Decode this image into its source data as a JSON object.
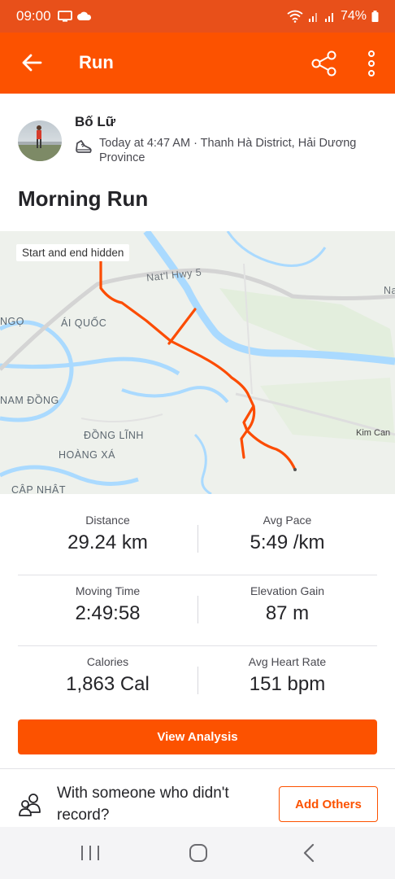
{
  "status_bar": {
    "time": "09:00",
    "battery": "74%"
  },
  "app_bar": {
    "title": "Run"
  },
  "athlete": {
    "name": "Bố Lữ",
    "meta": "Today at 4:47 AM · Thanh Hà District, Hải Dương Province"
  },
  "activity": {
    "title": "Morning Run"
  },
  "map": {
    "badge": "Start and end hidden",
    "road_label": "Nat'l Hwy 5",
    "road_label_2": "Na",
    "places": [
      "NGỌ",
      "ÁI QUỐC",
      "NAM ĐỒNG",
      "ĐỒNG LĨNH",
      "HOÀNG XÁ",
      "Kim Can",
      "CẬP NHẬT"
    ],
    "route_color": "#fc4c02"
  },
  "stats": [
    [
      {
        "label": "Distance",
        "value": "29.24 km"
      },
      {
        "label": "Avg Pace",
        "value": "5:49 /km"
      }
    ],
    [
      {
        "label": "Moving Time",
        "value": "2:49:58"
      },
      {
        "label": "Elevation Gain",
        "value": "87 m"
      }
    ],
    [
      {
        "label": "Calories",
        "value": "1,863 Cal"
      },
      {
        "label": "Avg Heart Rate",
        "value": "151 bpm"
      }
    ]
  ],
  "buttons": {
    "view_analysis": "View Analysis",
    "add_others": "Add Others"
  },
  "with_someone": "With someone who didn't record?",
  "colors": {
    "brand": "#fc5200",
    "status_bar": "#e8501a"
  }
}
